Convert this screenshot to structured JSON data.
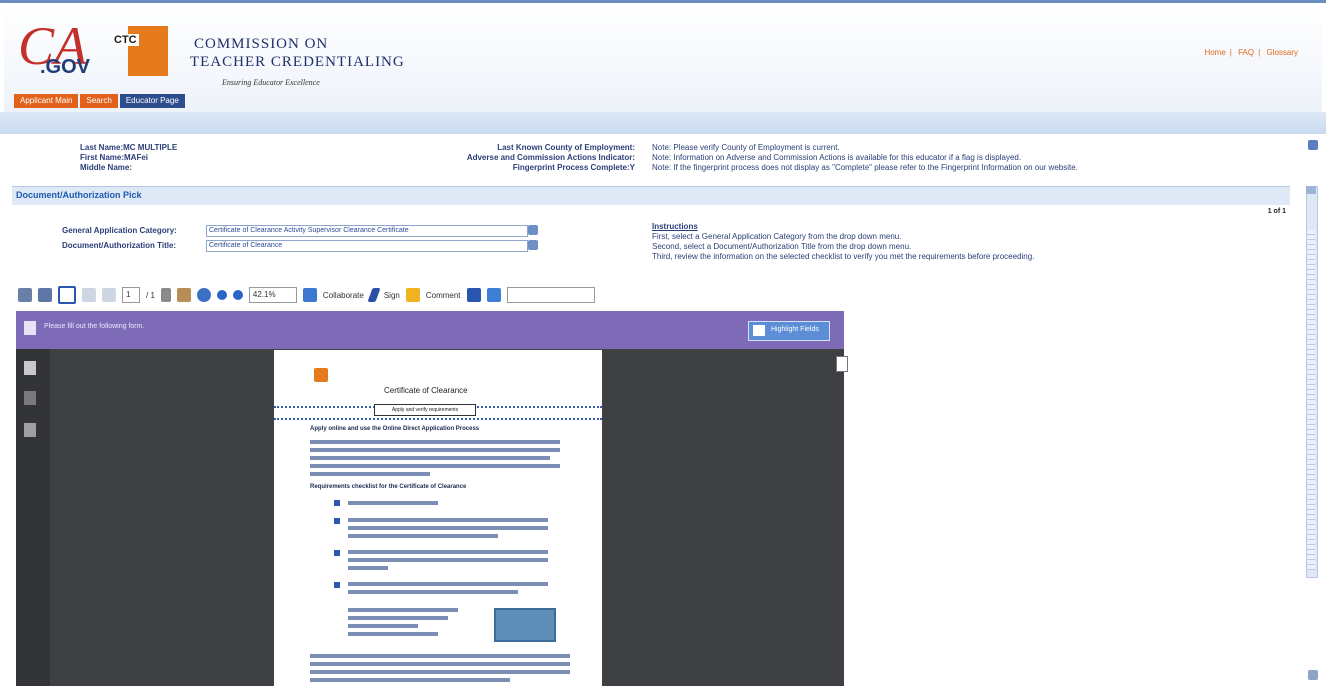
{
  "header": {
    "ca_logo_letter": "CA",
    "ca_logo_sub": ".GOV",
    "ctc_logo_text": "CTC",
    "title_line1": "COMMISSION ON",
    "title_line2": "TEACHER CREDENTIALING",
    "tagline": "Ensuring Educator Excellence",
    "links": [
      "Home",
      "FAQ",
      "Glossary"
    ],
    "tabs": [
      "Applicant Main",
      "Search",
      "Educator Page"
    ]
  },
  "info": {
    "last_name_label": "Last Name:",
    "last_name_value": "MC MULTIPLE",
    "first_name_label": "First Name:",
    "first_name_value": "MAFei",
    "middle_name_label": "Middle Name:",
    "county_label": "Last Known County of Employment:",
    "adverse_label": "Adverse and Commission Actions Indicator:",
    "fingerprint_label": "Fingerprint Process Complete:",
    "fingerprint_value": "Y",
    "note1": "Note: Please verify County of Employment is current.",
    "note2": "Note: Information on Adverse and Commission Actions is available for this educator if a flag is displayed.",
    "note3": "Note: If the fingerprint process does not display as \"Complete\" please refer to the Fingerprint Information on our website."
  },
  "section": {
    "title": "Document/Authorization Pick",
    "page_indicator": "1 of 1"
  },
  "form": {
    "category_label": "General Application Category:",
    "category_value": "Certificate of Clearance Activity Supervisor Clearance Certificate",
    "title_label": "Document/Authorization Title:",
    "title_value": "Certificate of Clearance"
  },
  "instructions": {
    "heading": "Instructions",
    "first": "First, select a General Application Category from the drop down menu.",
    "second": "Second, select a Document/Authorization Title from the drop down menu.",
    "third": "Third, review the information on the selected checklist to verify you met the requirements before proceeding."
  },
  "toolbar": {
    "page_value": "1",
    "page_total": "/ 1",
    "zoom": "42.1%",
    "collaborate": "Collaborate",
    "sign": "Sign",
    "comment": "Comment"
  },
  "viewer": {
    "bar_text": "Please fill out the following form.",
    "highlight_button": "Highlight Fields",
    "doc_title": "Certificate of Clearance",
    "doc_box": "Apply and verify requirements",
    "doc_heading1": "Apply online and use the Online Direct Application Process",
    "doc_heading2": "Requirements checklist for the Certificate of Clearance"
  },
  "colors": {
    "accent_orange": "#e2621b",
    "brand_blue": "#2a3f78",
    "viewer_bar": "#7d6bb8"
  }
}
